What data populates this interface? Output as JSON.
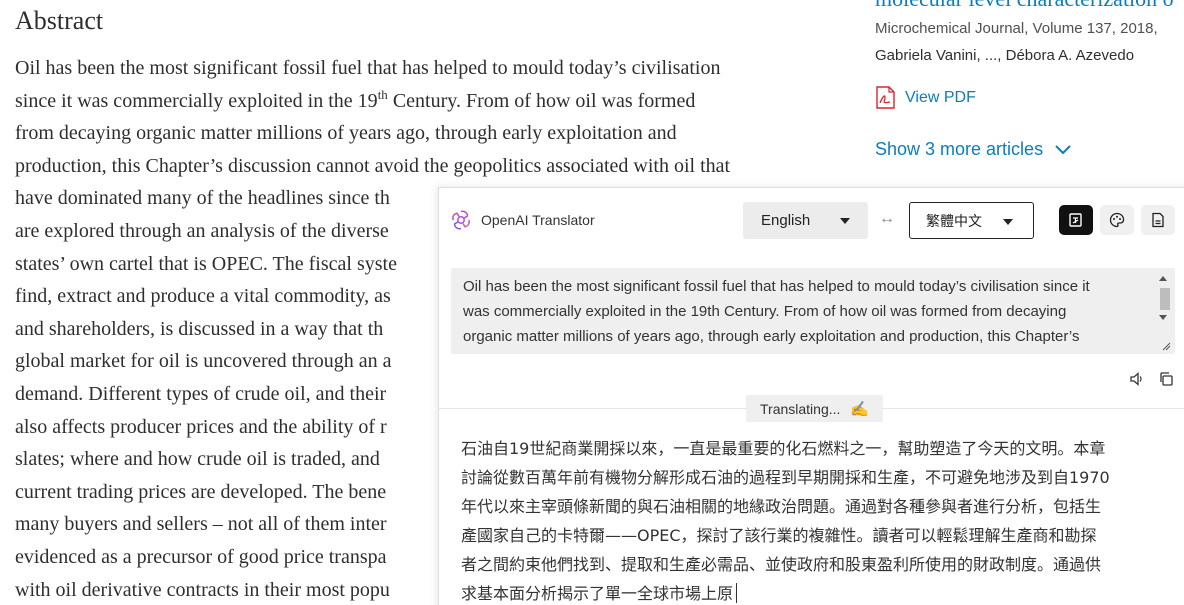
{
  "abstract": {
    "heading": "Abstract",
    "line1": "Oil has been the most significant fossil fuel that has helped to mould today’s civilisation",
    "line2_pre": "since it was commercially exploited in the 19",
    "line2_sup": "th",
    "line2_post": " Century. From of how oil was formed",
    "line3": "from decaying organic matter millions of years ago, through early exploitation and",
    "line4": "production, this Chapter’s discussion cannot avoid the geopolitics associated with oil that",
    "line5": "have dominated many of the headlines since th",
    "line6": "are explored through an analysis of the diverse",
    "line7": "states’ own cartel that is OPEC. The fiscal syste",
    "line8": "find, extract and produce a vital commodity, as",
    "line9": "and shareholders, is discussed in a way that th",
    "line10": "global market for oil is uncovered through an a",
    "line11": "demand. Different types of crude oil, and their",
    "line12": "also affects producer prices and the ability of r",
    "line13": "slates; where and how crude oil is traded, and",
    "line14": "current trading prices are developed. The bene",
    "line15": "many buyers and sellers – not all of them inter",
    "line16": "evidenced as a precursor of good price transpa",
    "line17": "with oil derivative contracts in their most popu"
  },
  "sidebar": {
    "article_title": "molecular level characterization o",
    "journal": "Microchemical Journal, Volume 137, 2018,",
    "authors": "Gabriela Vanini, ..., Débora A. Azevedo",
    "view_pdf": "View PDF",
    "show_more": "Show 3 more articles"
  },
  "translator": {
    "title": "OpenAI Translator",
    "source_lang": "English",
    "swap_symbol": "↔",
    "target_lang": "繁體中文",
    "source_lines": [
      "Oil has been the most significant fossil fuel that has helped to mould today’s civilisation since it",
      "was commercially exploited in the 19th Century. From of how oil was formed from decaying",
      "organic matter millions of years ago, through early exploitation and production, this Chapter’s"
    ],
    "status": "Translating...",
    "status_emoji": "✍",
    "output_lines": [
      "石油自19世紀商業開採以來，一直是最重要的化石燃料之一，幫助塑造了今天的文明。本章",
      "討論從數百萬年前有機物分解形成石油的過程到早期開採和生產，不可避免地涉及到自1970",
      "年代以來主宰頭條新聞的與石油相關的地緣政治問題。通過對各種參與者進行分析，包括生",
      "產國家自己的卡特爾——OPEC，探討了該行業的複雜性。讀者可以輕鬆理解生產商和勘探",
      "者之間約束他們找到、提取和生產必需品、並使政府和股東盈利所使用的財政制度。通過供",
      "求基本面分析揭示了單一全球市場上原"
    ]
  },
  "colors": {
    "link": "#0c7dbb",
    "pdf_red": "#d7262a",
    "active_button": "#111111"
  }
}
